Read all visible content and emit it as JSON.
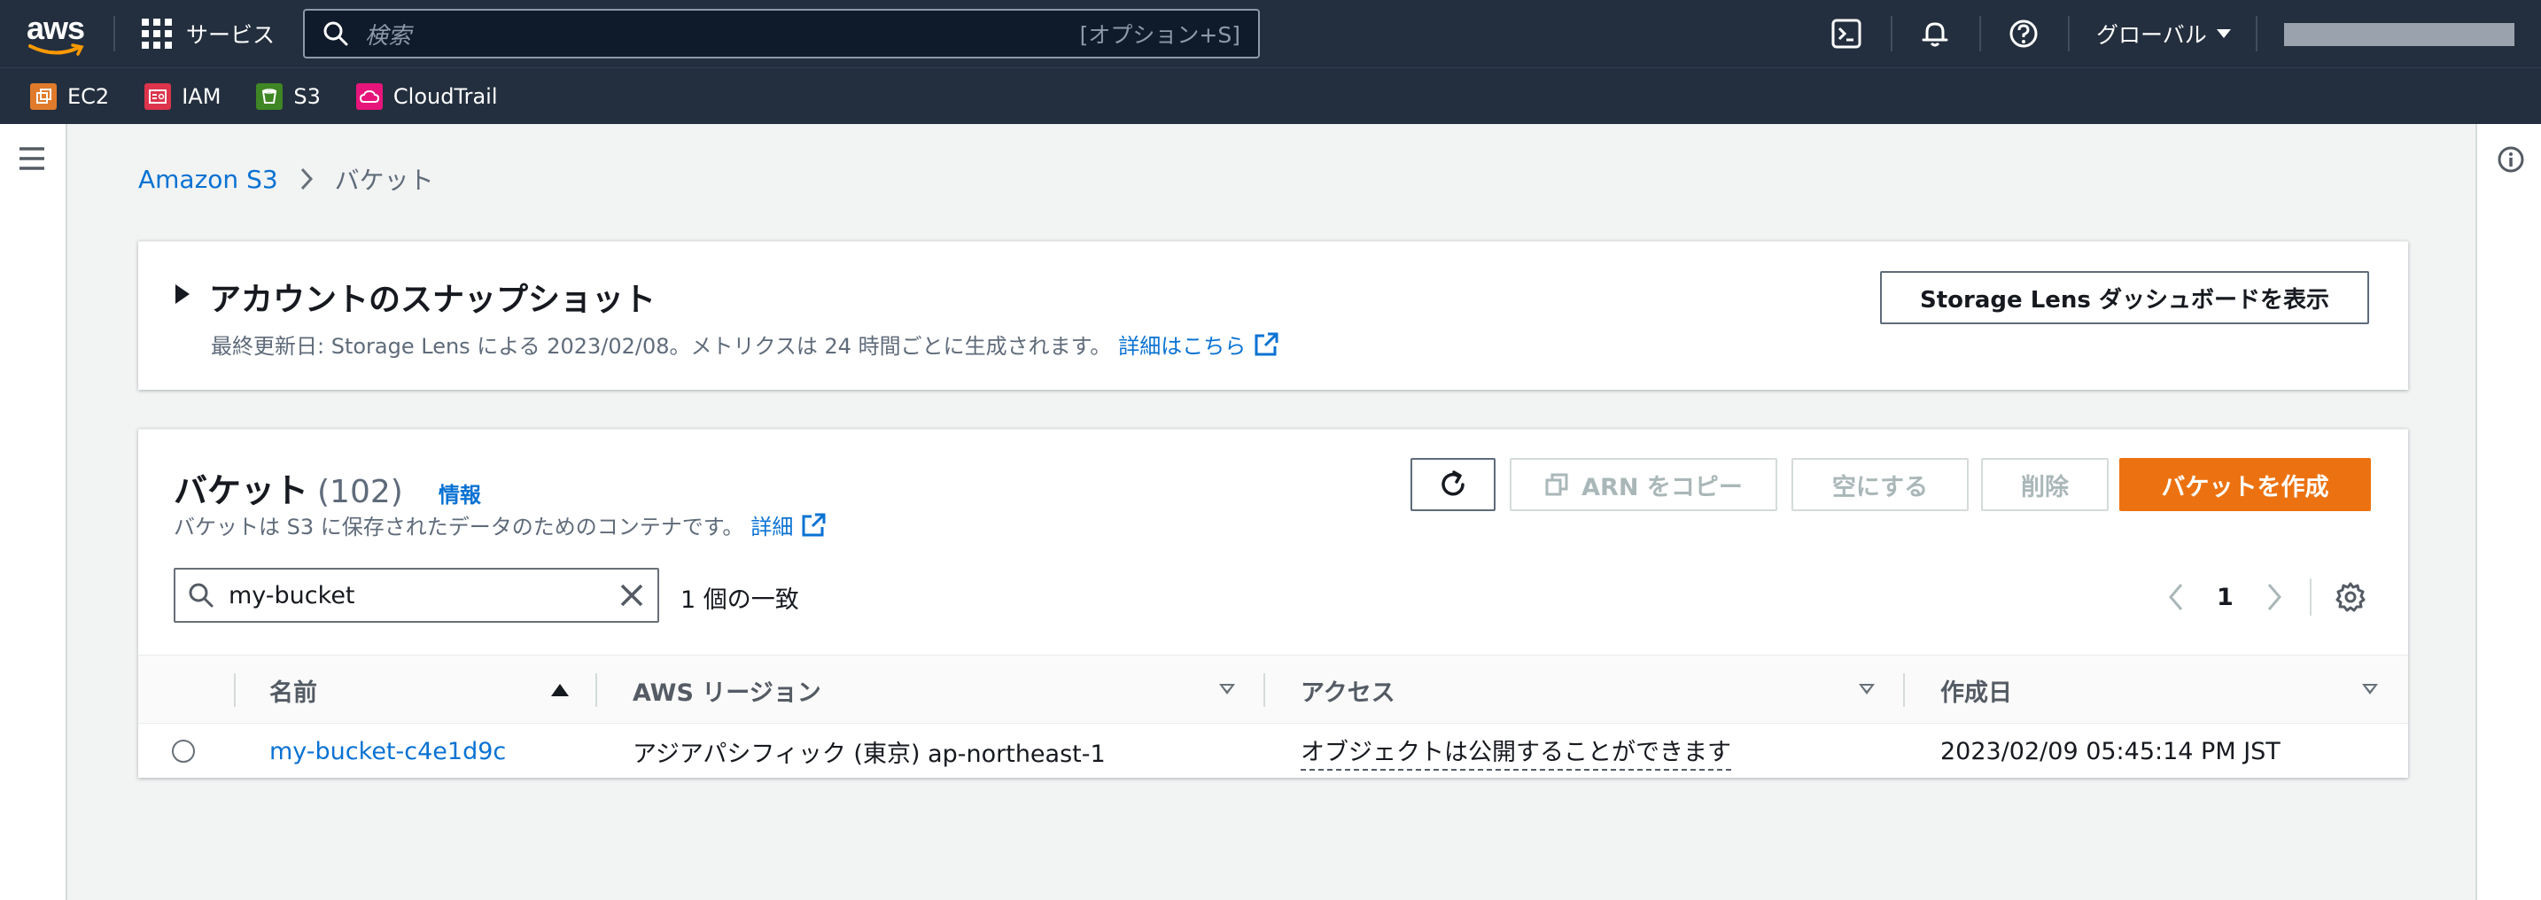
{
  "nav": {
    "logo_text": "aws",
    "services_label": "サービス",
    "search_placeholder": "検索",
    "search_shortcut": "[オプション+S]",
    "region_label": "グローバル"
  },
  "favorites": [
    {
      "label": "EC2",
      "color": "#e07b2b"
    },
    {
      "label": "IAM",
      "color": "#dd344c"
    },
    {
      "label": "S3",
      "color": "#3f8624"
    },
    {
      "label": "CloudTrail",
      "color": "#e7157b"
    }
  ],
  "breadcrumb": {
    "root": "Amazon S3",
    "current": "バケット"
  },
  "snapshot": {
    "title": "アカウントのスナップショット",
    "description": "最終更新日: Storage Lens による 2023/02/08。メトリクスは 24 時間ごとに生成されます。",
    "details_link": "詳細はこちら",
    "dashboard_button": "Storage Lens ダッシュボードを表示"
  },
  "buckets": {
    "title": "バケット",
    "count": "(102)",
    "info_link": "情報",
    "description": "バケットは S3 に保存されたデータのためのコンテナです。",
    "details_link": "詳細",
    "copy_arn_button": "ARN をコピー",
    "empty_button": "空にする",
    "delete_button": "削除",
    "create_button": "バケットを作成",
    "filter_value": "my-bucket",
    "match_count": "1 個の一致",
    "current_page": "1",
    "columns": {
      "name": "名前",
      "region": "AWS リージョン",
      "access": "アクセス",
      "created": "作成日"
    },
    "rows": [
      {
        "name": "my-bucket-c4e1d9c",
        "region": "アジアパシフィック (東京) ap-northeast-1",
        "access": "オブジェクトは公開することができます",
        "created": "2023/02/09 05:45:14 PM JST"
      }
    ]
  },
  "colors": {
    "nav_bg": "#232f3e",
    "link": "#0972d3",
    "primary": "#ec7211",
    "page_bg": "#f2f3f3"
  }
}
